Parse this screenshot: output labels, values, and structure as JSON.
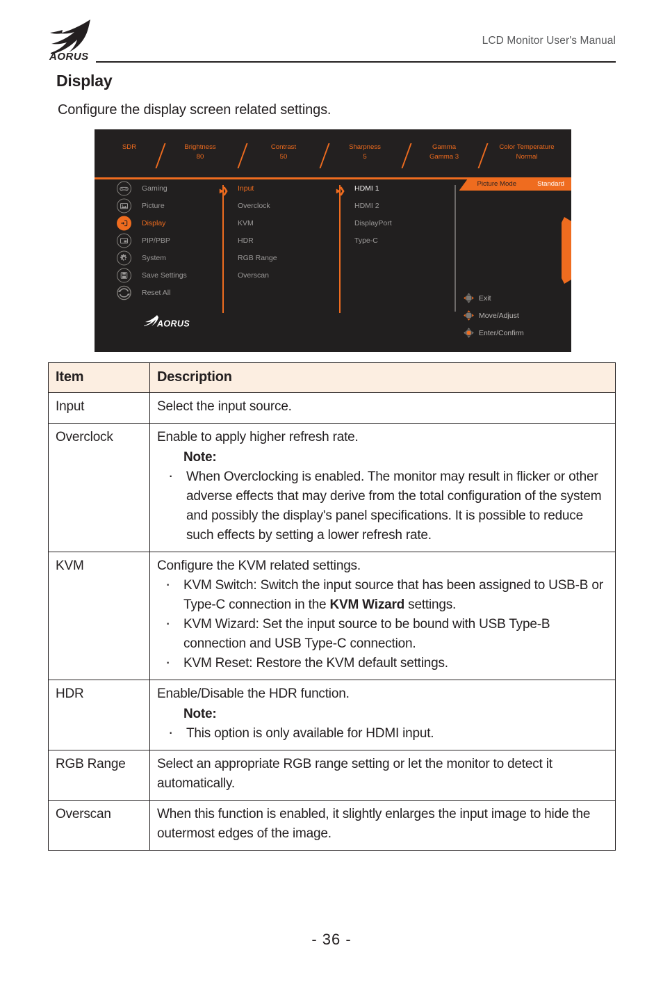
{
  "header": {
    "title": "LCD Monitor User's Manual",
    "logo_alt": "AORUS"
  },
  "section": {
    "title": "Display",
    "intro": "Configure the display screen related settings."
  },
  "osd": {
    "status_bar": [
      {
        "label": "SDR",
        "value": ""
      },
      {
        "label": "Brightness",
        "value": "80"
      },
      {
        "label": "Contrast",
        "value": "50"
      },
      {
        "label": "Sharpness",
        "value": "5"
      },
      {
        "label": "Gamma",
        "value": "Gamma 3"
      },
      {
        "label": "Color Temperature",
        "value": "Normal"
      }
    ],
    "picture_mode": {
      "label": "Picture Mode",
      "value": "Standard"
    },
    "column1": [
      {
        "label": "Gaming",
        "icon": "gamepad-icon",
        "state": "normal"
      },
      {
        "label": "Picture",
        "icon": "image-icon",
        "state": "normal"
      },
      {
        "label": "Display",
        "icon": "display-input-icon",
        "state": "active"
      },
      {
        "label": "PIP/PBP",
        "icon": "pip-icon",
        "state": "normal"
      },
      {
        "label": "System",
        "icon": "gear-icon",
        "state": "normal"
      },
      {
        "label": "Save Settings",
        "icon": "save-icon",
        "state": "normal"
      },
      {
        "label": "Reset All",
        "icon": "reset-icon",
        "state": "normal"
      }
    ],
    "column2": [
      {
        "label": "Input",
        "state": "active"
      },
      {
        "label": "Overclock",
        "state": "normal"
      },
      {
        "label": "KVM",
        "state": "normal"
      },
      {
        "label": "HDR",
        "state": "normal"
      },
      {
        "label": "RGB Range",
        "state": "normal"
      },
      {
        "label": "Overscan",
        "state": "normal"
      }
    ],
    "column3": [
      {
        "label": "HDMI 1",
        "state": "selected"
      },
      {
        "label": "HDMI 2",
        "state": "normal"
      },
      {
        "label": "DisplayPort",
        "state": "normal"
      },
      {
        "label": "Type-C",
        "state": "normal"
      }
    ],
    "nav_hints": [
      {
        "label": "Exit",
        "icon": "joystick-exit-icon"
      },
      {
        "label": "Move/Adjust",
        "icon": "joystick-move-icon"
      },
      {
        "label": "Enter/Confirm",
        "icon": "joystick-enter-icon"
      }
    ],
    "brand": "AORUS",
    "accent_color": "#ef6c1f",
    "background_color": "#211f1f"
  },
  "table": {
    "headers": {
      "item": "Item",
      "description": "Description"
    },
    "header_bg": "#fceee1",
    "rows": [
      {
        "item": "Input",
        "desc_main": "Select the input source."
      },
      {
        "item": "Overclock",
        "desc_main": "Enable to apply higher refresh rate.",
        "note_label": "Note:",
        "note_bullets": [
          "When Overclocking is enabled. The monitor may result in flicker or other adverse effects that may derive from the total configuration of the system and possibly the display's panel specifications. It is possible to reduce such effects by setting a lower refresh rate."
        ]
      },
      {
        "item": "KVM",
        "desc_main": "Configure the KVM related settings.",
        "bullets": [
          {
            "pre": "KVM Switch: Switch the input source that has been assigned to USB-B or Type-C connection in the ",
            "bold": "KVM Wizard",
            "post": " settings."
          },
          {
            "pre": "KVM Wizard: Set the input source to be bound with USB Type-B connection and USB Type-C connection.",
            "bold": "",
            "post": ""
          },
          {
            "pre": "KVM Reset: Restore the KVM default settings.",
            "bold": "",
            "post": ""
          }
        ]
      },
      {
        "item": "HDR",
        "desc_main": "Enable/Disable the HDR function.",
        "note_label": "Note:",
        "note_bullets": [
          "This option is only available for HDMI input."
        ]
      },
      {
        "item": "RGB Range",
        "desc_main": "Select an appropriate RGB range setting or let the monitor to detect it automatically."
      },
      {
        "item": "Overscan",
        "desc_main": "When this function is enabled, it slightly enlarges the input image to hide the outermost edges of the image."
      }
    ]
  },
  "footer": {
    "page_number": "- 36 -"
  }
}
